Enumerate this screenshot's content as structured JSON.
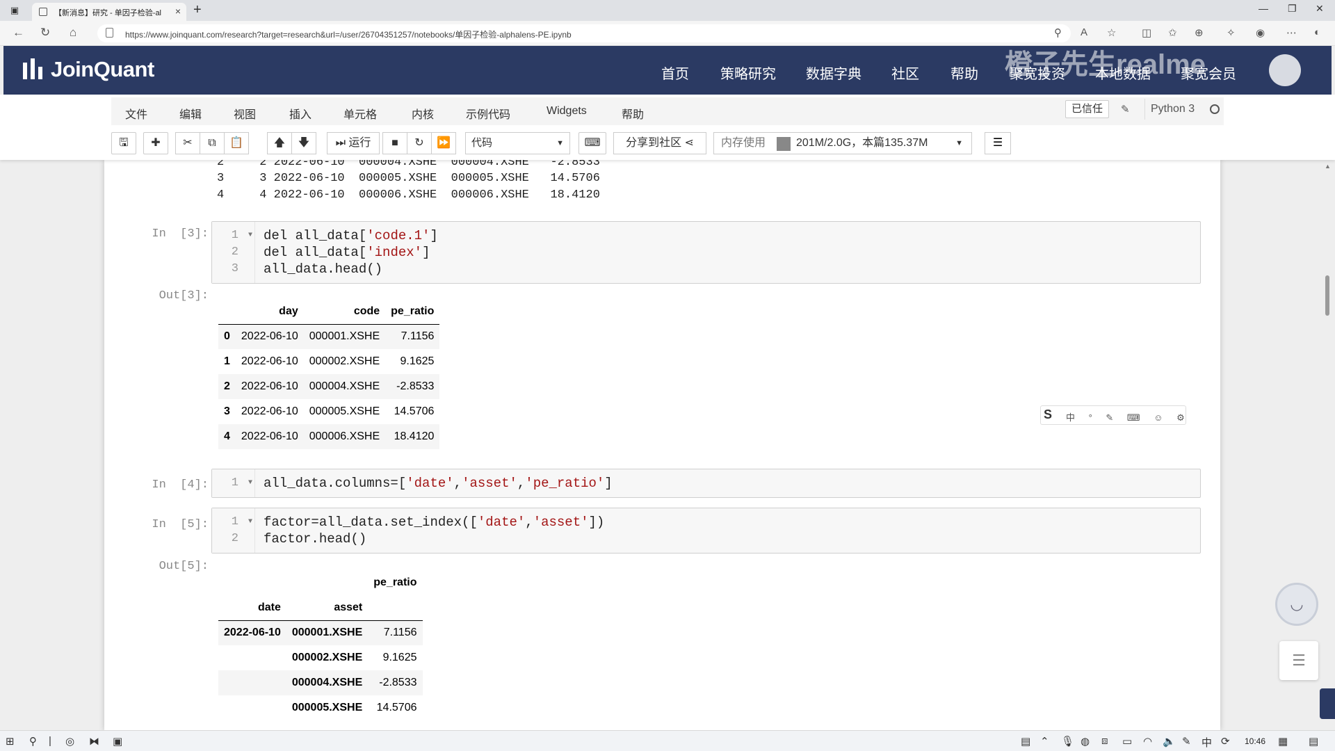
{
  "browser": {
    "tab_title": "【新消息】研究 - 单因子检验-al",
    "url": "https://www.joinquant.com/research?target=research&url=/user/26704351257/notebooks/单因子检验-alphalens-PE.ipynb"
  },
  "site": {
    "logo_text": "JoinQuant",
    "nav": [
      "首页",
      "策略研究",
      "数据字典",
      "社区",
      "帮助",
      "聚宽投资",
      "本地数据",
      "聚宽会员"
    ],
    "watermark": "橙子先生realme"
  },
  "notebook": {
    "menu": [
      "文件",
      "编辑",
      "视图",
      "插入",
      "单元格",
      "内核",
      "示例代码",
      "Widgets",
      "帮助"
    ],
    "trusted_label": "已信任",
    "kernel": "Python 3",
    "toolbar": {
      "run_label": "运行",
      "cell_type": "代码",
      "share_label": "分享到社区",
      "memory_label": "内存使用",
      "memory_value": "201M/2.0G，本篇135.37M"
    }
  },
  "prev_output_lines": [
    "2     2 2022-06-10  000004.XSHE  000004.XSHE   -2.8533",
    "3     3 2022-06-10  000005.XSHE  000005.XSHE   14.5706",
    "4     4 2022-06-10  000006.XSHE  000006.XSHE   18.4120"
  ],
  "cells": {
    "in3": {
      "prompt": "In  [3]:",
      "lines": [
        "del all_data['code.1']",
        "del all_data['index']",
        "all_data.head()"
      ]
    },
    "out3": {
      "prompt": "Out[3]:",
      "headers": [
        "",
        "day",
        "code",
        "pe_ratio"
      ],
      "rows": [
        [
          "0",
          "2022-06-10",
          "000001.XSHE",
          "7.1156"
        ],
        [
          "1",
          "2022-06-10",
          "000002.XSHE",
          "9.1625"
        ],
        [
          "2",
          "2022-06-10",
          "000004.XSHE",
          "-2.8533"
        ],
        [
          "3",
          "2022-06-10",
          "000005.XSHE",
          "14.5706"
        ],
        [
          "4",
          "2022-06-10",
          "000006.XSHE",
          "18.4120"
        ]
      ]
    },
    "in4": {
      "prompt": "In  [4]:",
      "lines": [
        "all_data.columns=['date','asset','pe_ratio']"
      ]
    },
    "in5": {
      "prompt": "In  [5]:",
      "lines": [
        "factor=all_data.set_index(['date','asset'])",
        "factor.head()"
      ]
    },
    "out5": {
      "prompt": "Out[5]:",
      "col_header": "pe_ratio",
      "index_names": [
        "date",
        "asset"
      ],
      "rows": [
        [
          "2022-06-10",
          "000001.XSHE",
          "7.1156"
        ],
        [
          "",
          "000002.XSHE",
          "9.1625"
        ],
        [
          "",
          "000004.XSHE",
          "-2.8533"
        ],
        [
          "",
          "000005.XSHE",
          "14.5706"
        ]
      ]
    }
  },
  "taskbar": {
    "clock": "10:46"
  }
}
